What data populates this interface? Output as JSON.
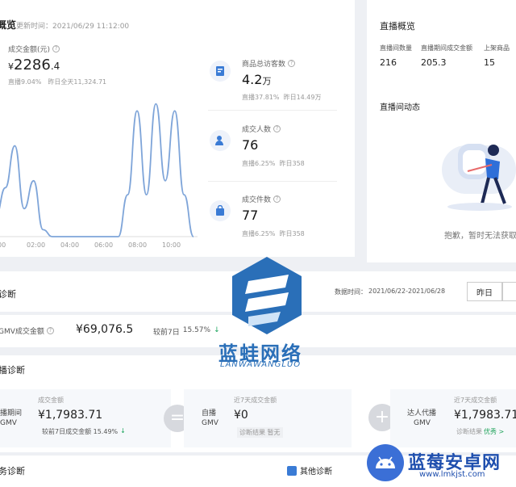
{
  "top": {
    "section_title": "概览",
    "update_time": "更新时间：2021/06/29 11:12:00"
  },
  "gmv_card": {
    "label": "成交金额(元)",
    "currency": "¥",
    "value": "2286",
    "decimal": ".4",
    "sub_live": "直播9.04%",
    "sub_yesterday": "昨日全天11,324.71"
  },
  "chart_data": {
    "type": "line",
    "x": [
      "00:00",
      "00:30",
      "01:00",
      "01:30",
      "02:00",
      "02:30",
      "03:00",
      "03:30",
      "04:00",
      "04:30",
      "05:00",
      "05:30",
      "06:00",
      "06:30",
      "07:00",
      "07:30",
      "08:00",
      "08:30",
      "09:00",
      "09:30",
      "10:00",
      "10:30"
    ],
    "values": [
      0.15,
      0.35,
      0.65,
      0.2,
      0.4,
      0.05,
      0,
      0,
      0,
      0,
      0,
      0,
      0,
      0,
      0.3,
      0.9,
      0.3,
      0.95,
      0.4,
      0.9,
      0.3,
      0
    ],
    "x_tick_labels": [
      "00",
      "02:00",
      "04:00",
      "06:00",
      "08:00",
      "10:00"
    ],
    "color": "#7fa5d9",
    "ylim": [
      0,
      1
    ]
  },
  "metrics": [
    {
      "label": "商品总访客数",
      "value": "4.2",
      "unit": "万",
      "sub": "直播37.81%  昨日14.49万",
      "icon": "person-list-icon"
    },
    {
      "label": "成交人数",
      "value": "76",
      "unit": "",
      "sub": "直播6.25%  昨日358",
      "icon": "person-check-icon"
    },
    {
      "label": "成交件数",
      "value": "77",
      "unit": "",
      "sub": "直播6.25%  昨日358",
      "icon": "bag-icon"
    }
  ],
  "live_overview": {
    "title": "直播概览",
    "columns": [
      "直播间数量",
      "直播期间成交金额",
      "上架商品"
    ],
    "values": [
      "216",
      "205.3",
      "15"
    ],
    "dynamics_title": "直播间动态",
    "empty_text": "抱歉，暂时无法获取"
  },
  "diagnosis": {
    "title": "诊断",
    "date_label": "数据时间：",
    "date_range": "2021/06/22-2021/06/28",
    "btn_yesterday": "昨日",
    "gmv_label": "GMV成交金额",
    "gmv_value": "¥69,076.5",
    "compare_label": "较前7日",
    "compare_value": "15.57%",
    "compare_arrow": "↓"
  },
  "live_diag": {
    "title": "播诊断",
    "col1_label1": "播期间",
    "col1_label2": "GMV",
    "col1_amount_label": "成交金额",
    "col1_amount": "¥1,7983.71",
    "col1_compare": "较前7日成交金额 15.49%",
    "col1_arrow": "↓",
    "equals": "=",
    "col2_label1": "自播",
    "col2_label2": "GMV",
    "col2_amount_label": "近7天成交金额",
    "col2_amount": "¥0",
    "col2_result": "诊断结果 暂无",
    "plus": "+",
    "col3_label1": "达人代播",
    "col3_label2": "GMV",
    "col3_amount_label": "近7天成交金额",
    "col3_amount": "¥1,7983.71",
    "col3_result": "诊断结果",
    "col3_result_tag": "优秀 >"
  },
  "business_diag": {
    "title": "务诊断",
    "other_diag": "其他诊断"
  },
  "watermark": {
    "brand_cn": "蓝蛙网络",
    "brand_en": "LANWAWANGLUO",
    "corner_cn": "蓝莓安卓网",
    "corner_url": "www.lmkjst.com"
  },
  "colors": {
    "accent": "#3a7bd5",
    "chart_line": "#7fa5d9",
    "green": "#1fa35a",
    "logo_blue": "#2a6fb8"
  }
}
